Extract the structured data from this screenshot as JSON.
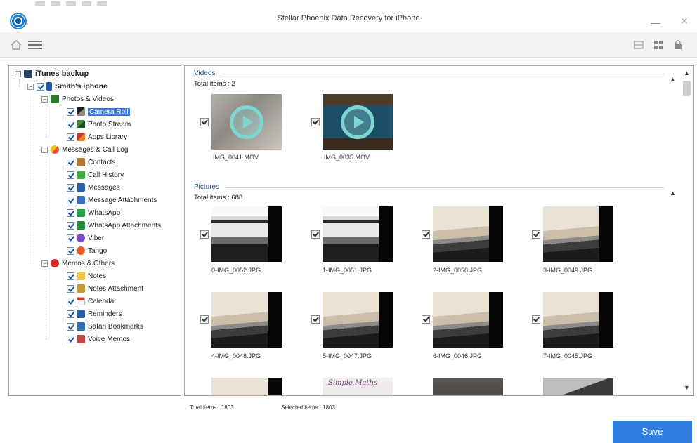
{
  "window": {
    "title": "Stellar Phoenix Data Recovery for iPhone",
    "minimize": "—",
    "close": "✕"
  },
  "toolbar": {
    "icons": [
      "home-icon",
      "menu-icon",
      "list-view-icon",
      "grid-view-icon",
      "lock-icon"
    ]
  },
  "tree": {
    "root": "iTunes backup",
    "device": "Smith's iphone",
    "groups": [
      {
        "label": "Photos & Videos",
        "items": [
          "Camera Roll",
          "Photo Stream",
          "Apps Library"
        ]
      },
      {
        "label": "Messages & Call Log",
        "items": [
          "Contacts",
          "Call History",
          "Messages",
          "Message Attachments",
          "WhatsApp",
          "WhatsApp Attachments",
          "Viber",
          "Tango"
        ]
      },
      {
        "label": "Memos & Others",
        "items": [
          "Notes",
          "Notes Attachment",
          "Calendar",
          "Reminders",
          "Safari Bookmarks",
          "Voice Memos"
        ]
      }
    ],
    "selected": "Camera Roll"
  },
  "videos": {
    "title": "Videos",
    "count": "Total items : 2",
    "items": [
      "IMG_0041.MOV",
      "IMG_0035.MOV"
    ]
  },
  "pictures": {
    "title": "Pictures",
    "count": "Total items : 688",
    "items": [
      "0-IMG_0052.JPG",
      "1-IMG_0051.JPG",
      "2-IMG_0050.JPG",
      "3-IMG_0049.JPG",
      "4-IMG_0048.JPG",
      "5-IMG_0047.JPG",
      "6-IMG_0046.JPG",
      "7-IMG_0045.JPG"
    ],
    "partial_thumb_text": "Simple Maths"
  },
  "footer": {
    "total": "Total items : 1803",
    "selected": "Selected items : 1803",
    "save": "Save"
  },
  "colors": {
    "accent": "#2f7fe0",
    "selection": "#3b78d8",
    "section_title": "#2a56a0"
  }
}
